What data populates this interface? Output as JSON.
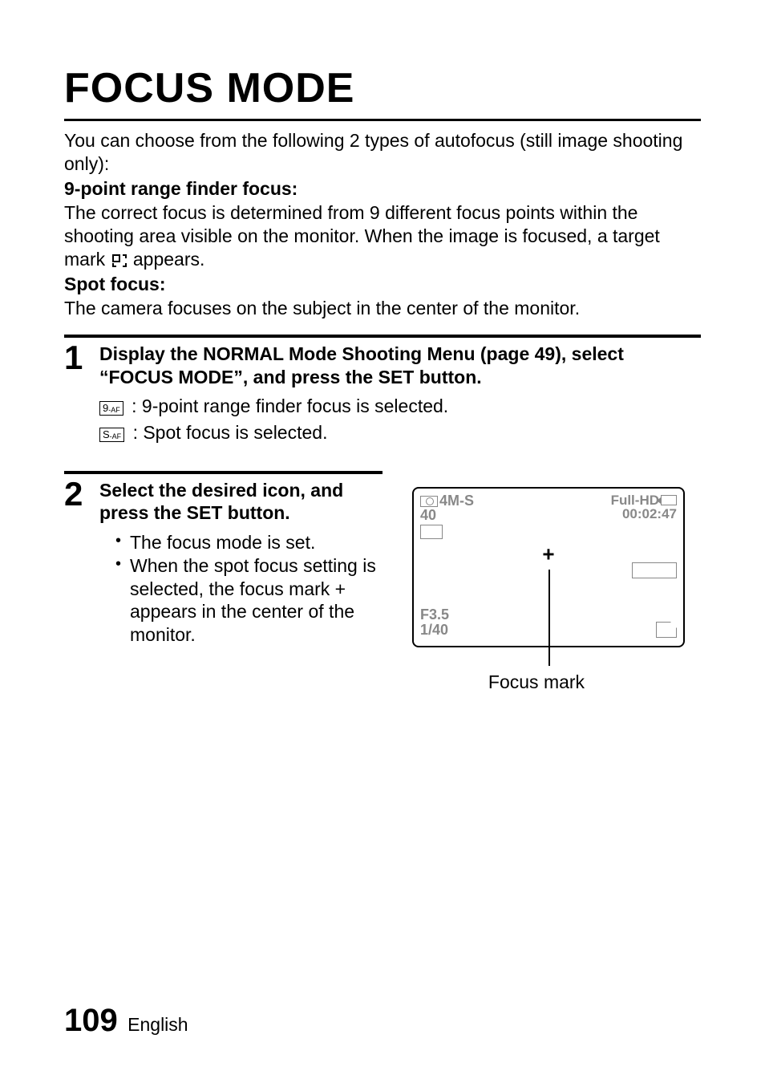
{
  "title": "FOCUS MODE",
  "intro": {
    "line1": "You can choose from the following 2 types of autofocus (still image shooting only):",
    "nine_point_label": "9-point range finder focus:",
    "nine_point_desc_a": "The correct focus is determined from 9 different focus points within the shooting area visible on the monitor. When the image is focused, a target mark ",
    "nine_point_desc_b": " appears.",
    "spot_label": "Spot focus:",
    "spot_desc": "The camera focuses on the subject in the center of the monitor."
  },
  "step1": {
    "num": "1",
    "title": "Display the NORMAL Mode Shooting Menu (page 49), select “FOCUS MODE”, and press the SET button.",
    "icon9": "9",
    "iconAF": "-AF",
    "iconS": "S",
    "def1": ": 9-point range finder focus is selected.",
    "def2": ": Spot focus is selected."
  },
  "step2": {
    "num": "2",
    "title": "Select the desired icon, and press the SET button.",
    "b1": "The focus mode is set.",
    "b2": "When the spot focus setting is selected, the focus mark + appears in the center of the monitor."
  },
  "screen": {
    "resolution": "4M-S",
    "count": "40",
    "fullhd": "Full-HD",
    "time": "00:02:47",
    "aperture": "F3.5",
    "shutter": "1/40"
  },
  "callout": "Focus mark",
  "footer": {
    "page": "109",
    "lang": "English"
  }
}
